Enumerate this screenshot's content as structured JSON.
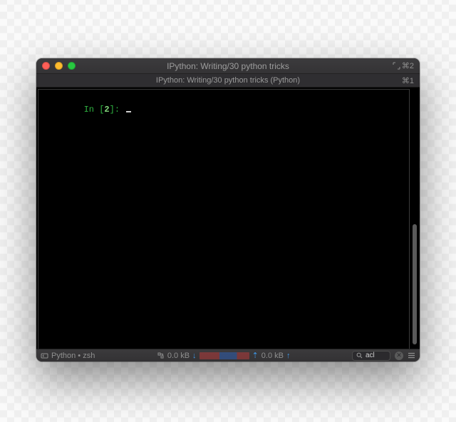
{
  "window": {
    "title": "IPython: Writing/30 python tricks",
    "right_shortcut": "⌘2"
  },
  "tab": {
    "title": "IPython: Writing/30 python tricks (Python)",
    "shortcut": "⌘1"
  },
  "terminal": {
    "prompt_prefix": "In ",
    "prompt_open": "[",
    "prompt_number": "2",
    "prompt_close": "]: "
  },
  "statusbar": {
    "process_label": "Python • zsh",
    "net_down_label": "0.0 kB",
    "net_down_arrow": "↓",
    "net_up_label": "0.0 kB",
    "net_up_arrow": "↑",
    "upload_prefix": "⇡",
    "search_placeholder": "acl",
    "search_value": "acl"
  }
}
